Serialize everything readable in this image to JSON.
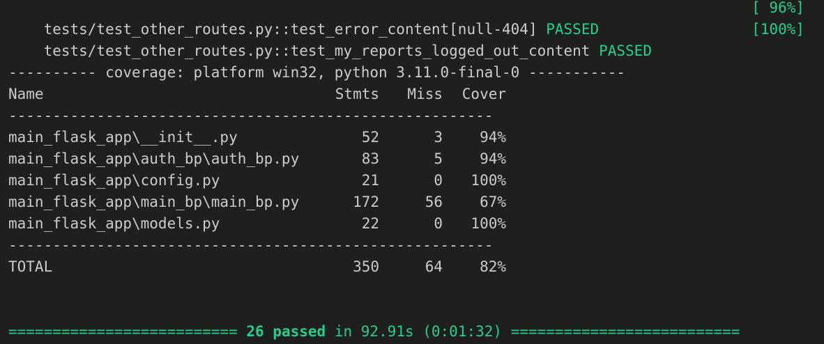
{
  "tests": [
    {
      "name": "tests/test_other_routes.py::test_error_content[null-404]",
      "status": "PASSED",
      "progress": "[ 96%]"
    },
    {
      "name": "tests/test_other_routes.py::test_my_reports_logged_out_content",
      "status": "PASSED",
      "progress": "[100%]"
    }
  ],
  "coverage": {
    "header": "---------- coverage: platform win32, python 3.11.0-final-0 -----------",
    "columns": [
      "Name",
      "Stmts",
      "Miss",
      "Cover"
    ],
    "separator": "-------------------------------------------------------",
    "rows": [
      {
        "name": "main_flask_app\\__init__.py",
        "stmts": "52",
        "miss": "3",
        "cover": "94%"
      },
      {
        "name": "main_flask_app\\auth_bp\\auth_bp.py",
        "stmts": "83",
        "miss": "5",
        "cover": "94%"
      },
      {
        "name": "main_flask_app\\config.py",
        "stmts": "21",
        "miss": "0",
        "cover": "100%"
      },
      {
        "name": "main_flask_app\\main_bp\\main_bp.py",
        "stmts": "172",
        "miss": "56",
        "cover": "67%"
      },
      {
        "name": "main_flask_app\\models.py",
        "stmts": "22",
        "miss": "0",
        "cover": "100%"
      }
    ],
    "total": {
      "name": "TOTAL",
      "stmts": "350",
      "miss": "64",
      "cover": "82%"
    }
  },
  "summary": {
    "left_rule": "========================== ",
    "passed": "26 passed",
    "rest": " in 92.91s (0:01:32) ",
    "right_rule": "=========================="
  },
  "colors": {
    "background": "#1f1f1f",
    "text": "#cccccc",
    "pass_green": "#23d18b"
  }
}
